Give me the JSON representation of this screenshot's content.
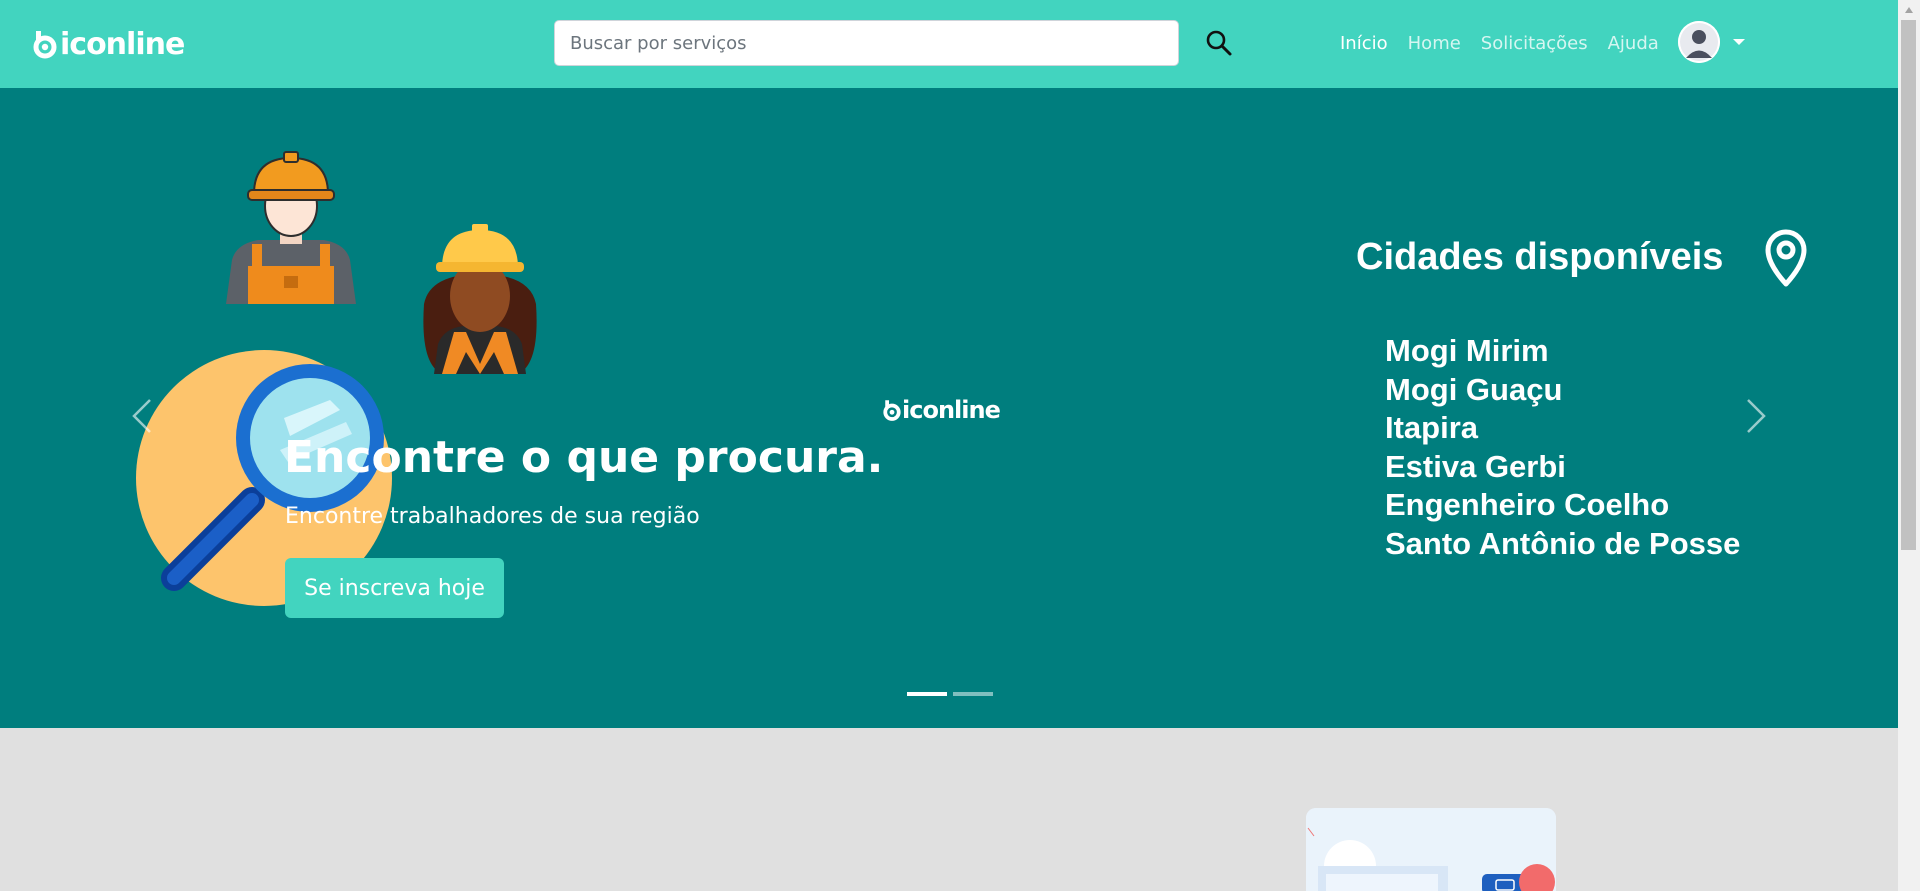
{
  "navbar": {
    "brand": "iconline",
    "search_placeholder": "Buscar por serviços",
    "search_value": "",
    "links": [
      "Início",
      "Home",
      "Solicitações",
      "Ajuda"
    ],
    "active_link": "Início",
    "icons": {
      "search": "search-icon",
      "avatar": "user-avatar",
      "caret": "chevron-down-icon"
    }
  },
  "hero": {
    "title": "Encontre o que procura.",
    "subtitle": "Encontre trabalhadores de sua região",
    "cta": "Se inscreva hoje",
    "center_logo": "iconline",
    "cities_title": "Cidades disponíveis",
    "cities": [
      "Mogi Mirim",
      "Mogi Guaçu",
      "Itapira",
      "Estiva Gerbi",
      "Engenheiro Coelho",
      "Santo Antônio de Posse"
    ],
    "slides_total": 2,
    "active_slide": 1,
    "icons": {
      "prev": "chevron-left-icon",
      "next": "chevron-right-icon",
      "pin": "map-pin-icon"
    }
  },
  "colors": {
    "navbar": "#42d4bf",
    "hero_bg": "#007e7e",
    "cta": "#42d4bf",
    "page_bg": "#e0e0e0"
  }
}
